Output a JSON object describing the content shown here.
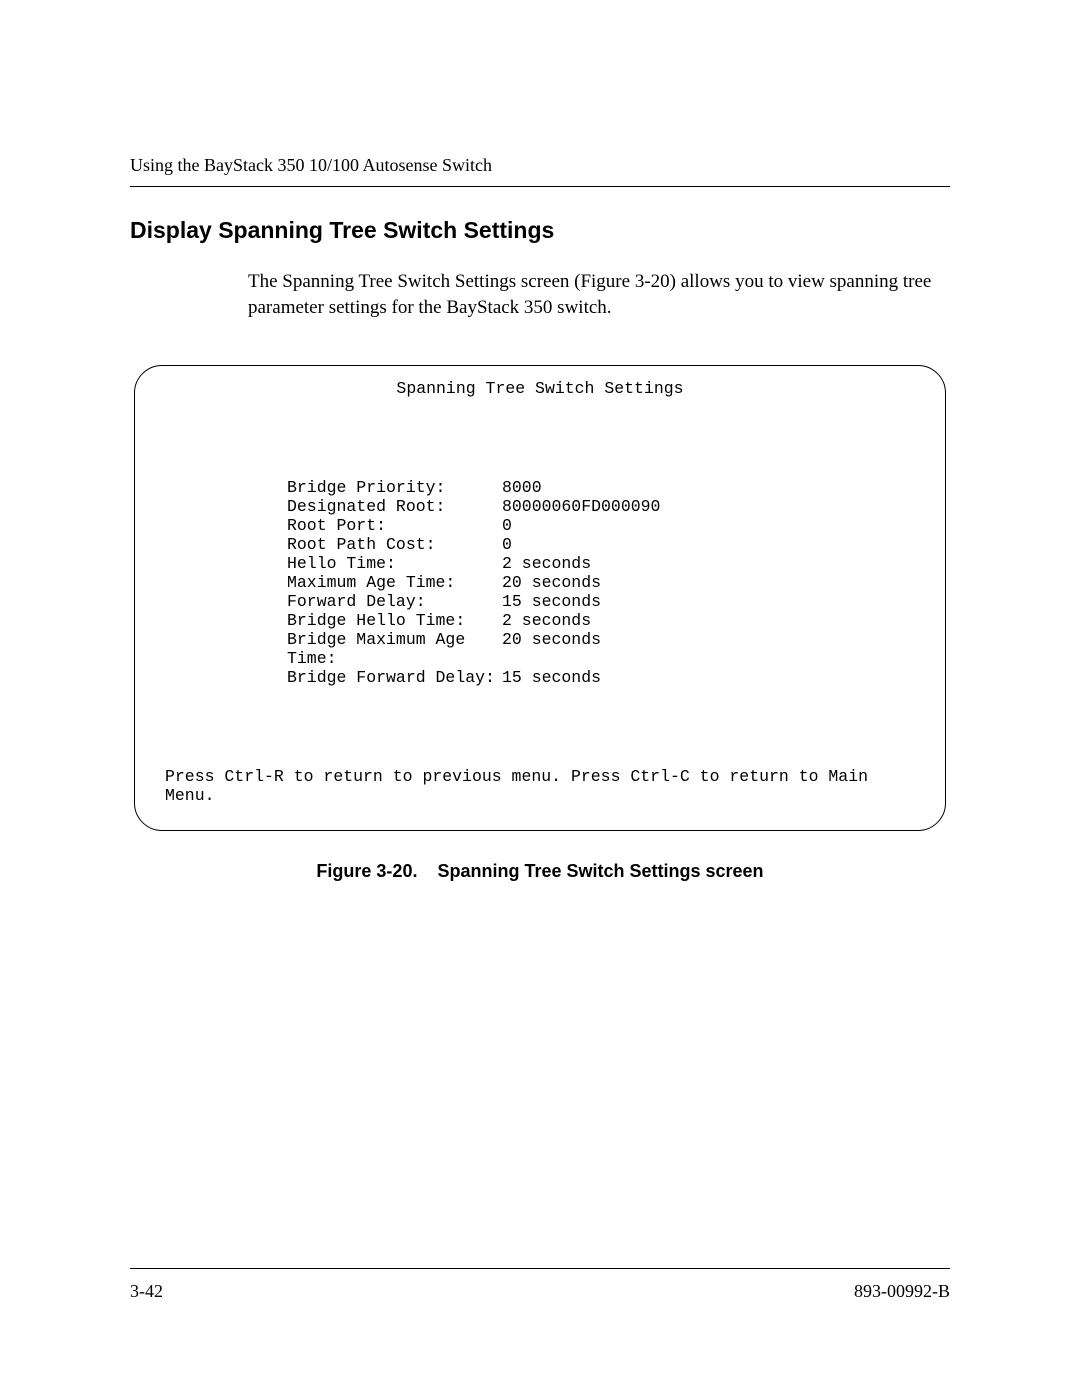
{
  "header": {
    "running_title": "Using the BayStack 350 10/100 Autosense Switch"
  },
  "section": {
    "heading": "Display Spanning Tree Switch Settings",
    "body": "The Spanning Tree Switch Settings screen (Figure 3-20) allows you to view spanning tree parameter settings for the BayStack 350 switch."
  },
  "figure": {
    "screen_title": "Spanning Tree Switch Settings",
    "settings": [
      {
        "label": "Bridge Priority:",
        "value": "8000"
      },
      {
        "label": "Designated Root:",
        "value": "80000060FD000090"
      },
      {
        "label": "Root Port:",
        "value": "0"
      },
      {
        "label": "Root Path Cost:",
        "value": "0"
      },
      {
        "label": "Hello Time:",
        "value": "2 seconds"
      },
      {
        "label": "Maximum Age Time:",
        "value": "20 seconds"
      },
      {
        "label": "Forward Delay:",
        "value": "15 seconds"
      },
      {
        "label": "Bridge Hello Time:",
        "value": "2 seconds"
      },
      {
        "label": "Bridge Maximum Age Time:",
        "value": "20 seconds"
      },
      {
        "label": "Bridge Forward Delay:",
        "value": "15 seconds"
      }
    ],
    "footer_instruction": "Press Ctrl-R to return to previous menu.  Press Ctrl-C to return to Main Menu.",
    "caption_prefix": "Figure 3-20.",
    "caption_text": "Spanning Tree Switch Settings screen"
  },
  "footer": {
    "page_number": "3-42",
    "doc_number": "893-00992-B"
  }
}
